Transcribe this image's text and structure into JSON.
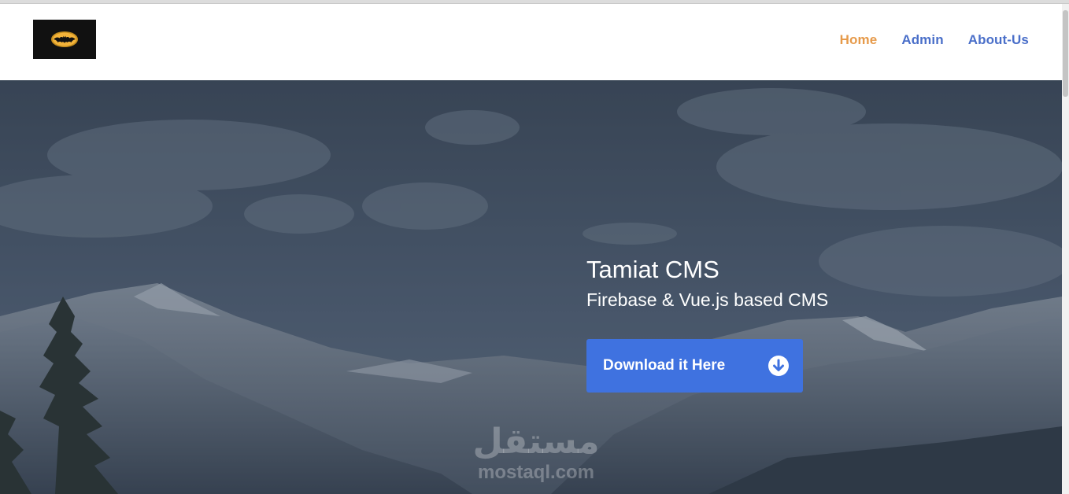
{
  "nav": {
    "items": [
      {
        "label": "Home",
        "active": true
      },
      {
        "label": "Admin",
        "active": false
      },
      {
        "label": "About-Us",
        "active": false
      }
    ]
  },
  "logo": {
    "icon": "bat-logo-icon"
  },
  "hero": {
    "title": "Tamiat CMS",
    "subtitle": "Firebase & Vue.js based CMS",
    "cta_label": "Download it Here",
    "cta_icon": "arrow-down-circle-icon"
  },
  "watermark": {
    "arabic": "مستقل",
    "latin": "mostaql.com"
  },
  "colors": {
    "nav_active": "#e69a4a",
    "nav_link": "#4a6fc9",
    "button": "#3f72e0",
    "hero_overlay": "#2e3a4a"
  }
}
